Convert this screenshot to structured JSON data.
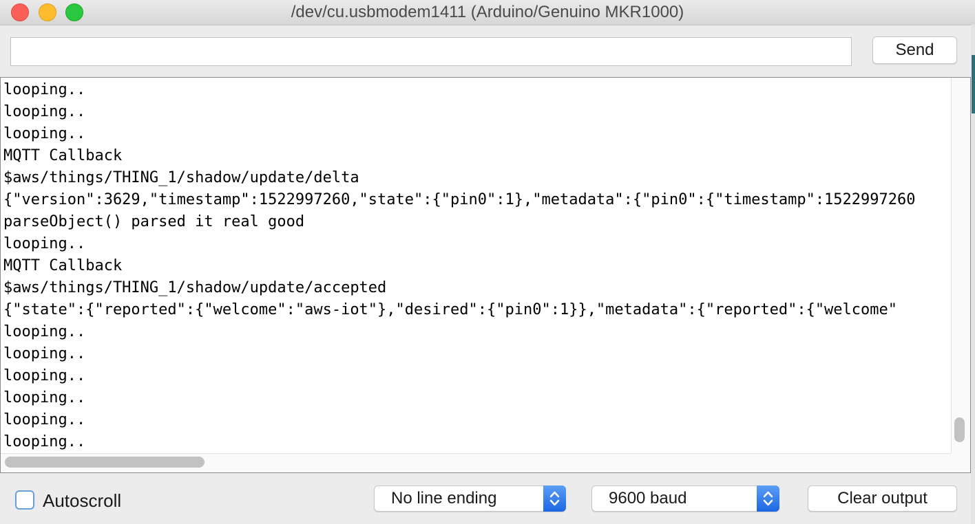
{
  "window": {
    "title": "/dev/cu.usbmodem1411 (Arduino/Genuino MKR1000)"
  },
  "send_bar": {
    "input_value": "",
    "send_label": "Send"
  },
  "output": {
    "lines": [
      "looping..",
      "looping..",
      "looping..",
      "MQTT Callback",
      "$aws/things/THING_1/shadow/update/delta",
      "{\"version\":3629,\"timestamp\":1522997260,\"state\":{\"pin0\":1},\"metadata\":{\"pin0\":{\"timestamp\":1522997260",
      "parseObject() parsed it real good",
      "looping..",
      "MQTT Callback",
      "$aws/things/THING_1/shadow/update/accepted",
      "{\"state\":{\"reported\":{\"welcome\":\"aws-iot\"},\"desired\":{\"pin0\":1}},\"metadata\":{\"reported\":{\"welcome\"",
      "looping..",
      "looping..",
      "looping..",
      "looping..",
      "looping..",
      "looping.."
    ]
  },
  "bottom_bar": {
    "autoscroll_label": "Autoscroll",
    "autoscroll_checked": false,
    "line_ending_value": "No line ending",
    "baud_value": "9600 baud",
    "clear_label": "Clear output"
  },
  "colors": {
    "close": "#fc5f57",
    "minimize": "#fdbc2e",
    "zoom": "#29c840",
    "accent": "#1c66e2"
  },
  "icons": [
    "close-icon",
    "minimize-icon",
    "zoom-icon",
    "chevron-updown-icon"
  ]
}
